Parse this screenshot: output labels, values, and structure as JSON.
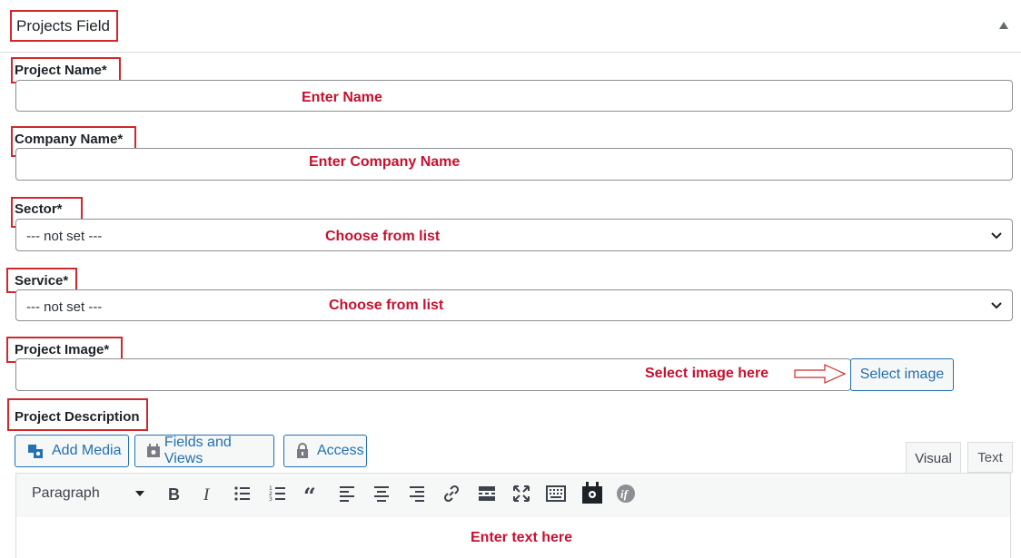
{
  "panel": {
    "title": "Projects Field",
    "collapse_icon": "triangle-up-icon"
  },
  "fields": {
    "project_name": {
      "label": "Project Name*",
      "hint": "Enter Name",
      "value": ""
    },
    "company_name": {
      "label": "Company Name*",
      "hint": "Enter Company Name",
      "value": ""
    },
    "sector": {
      "label": "Sector*",
      "selected": "--- not set ---",
      "hint": "Choose from list"
    },
    "service": {
      "label": "Service*",
      "selected": "--- not set ---",
      "hint": "Choose from list"
    },
    "project_image": {
      "label": "Project Image*",
      "hint": "Select image here",
      "button": "Select image"
    },
    "project_description": {
      "label": "Project Description"
    }
  },
  "media_buttons": [
    {
      "label": "Add Media",
      "icon": "media-icon"
    },
    {
      "label": "Fields and Views",
      "icon": "calendar-icon"
    },
    {
      "label": "Access",
      "icon": "lock-icon"
    }
  ],
  "editor_tabs": [
    {
      "label": "Visual"
    },
    {
      "label": "Text"
    }
  ],
  "toolbar": {
    "format_select": "Paragraph",
    "icons": [
      "bold-icon",
      "italic-icon",
      "bullet-list-icon",
      "numbered-list-icon",
      "blockquote-icon",
      "align-left-icon",
      "align-center-icon",
      "align-right-icon",
      "link-icon",
      "read-more-icon",
      "fullscreen-icon",
      "keyboard-icon",
      "fields-icon",
      "conditional-icon"
    ]
  },
  "editor": {
    "hint": "Enter text here"
  },
  "colors": {
    "annotation_red": "#d1282e",
    "hint_red": "#c8102e",
    "wp_blue": "#2271b1"
  }
}
